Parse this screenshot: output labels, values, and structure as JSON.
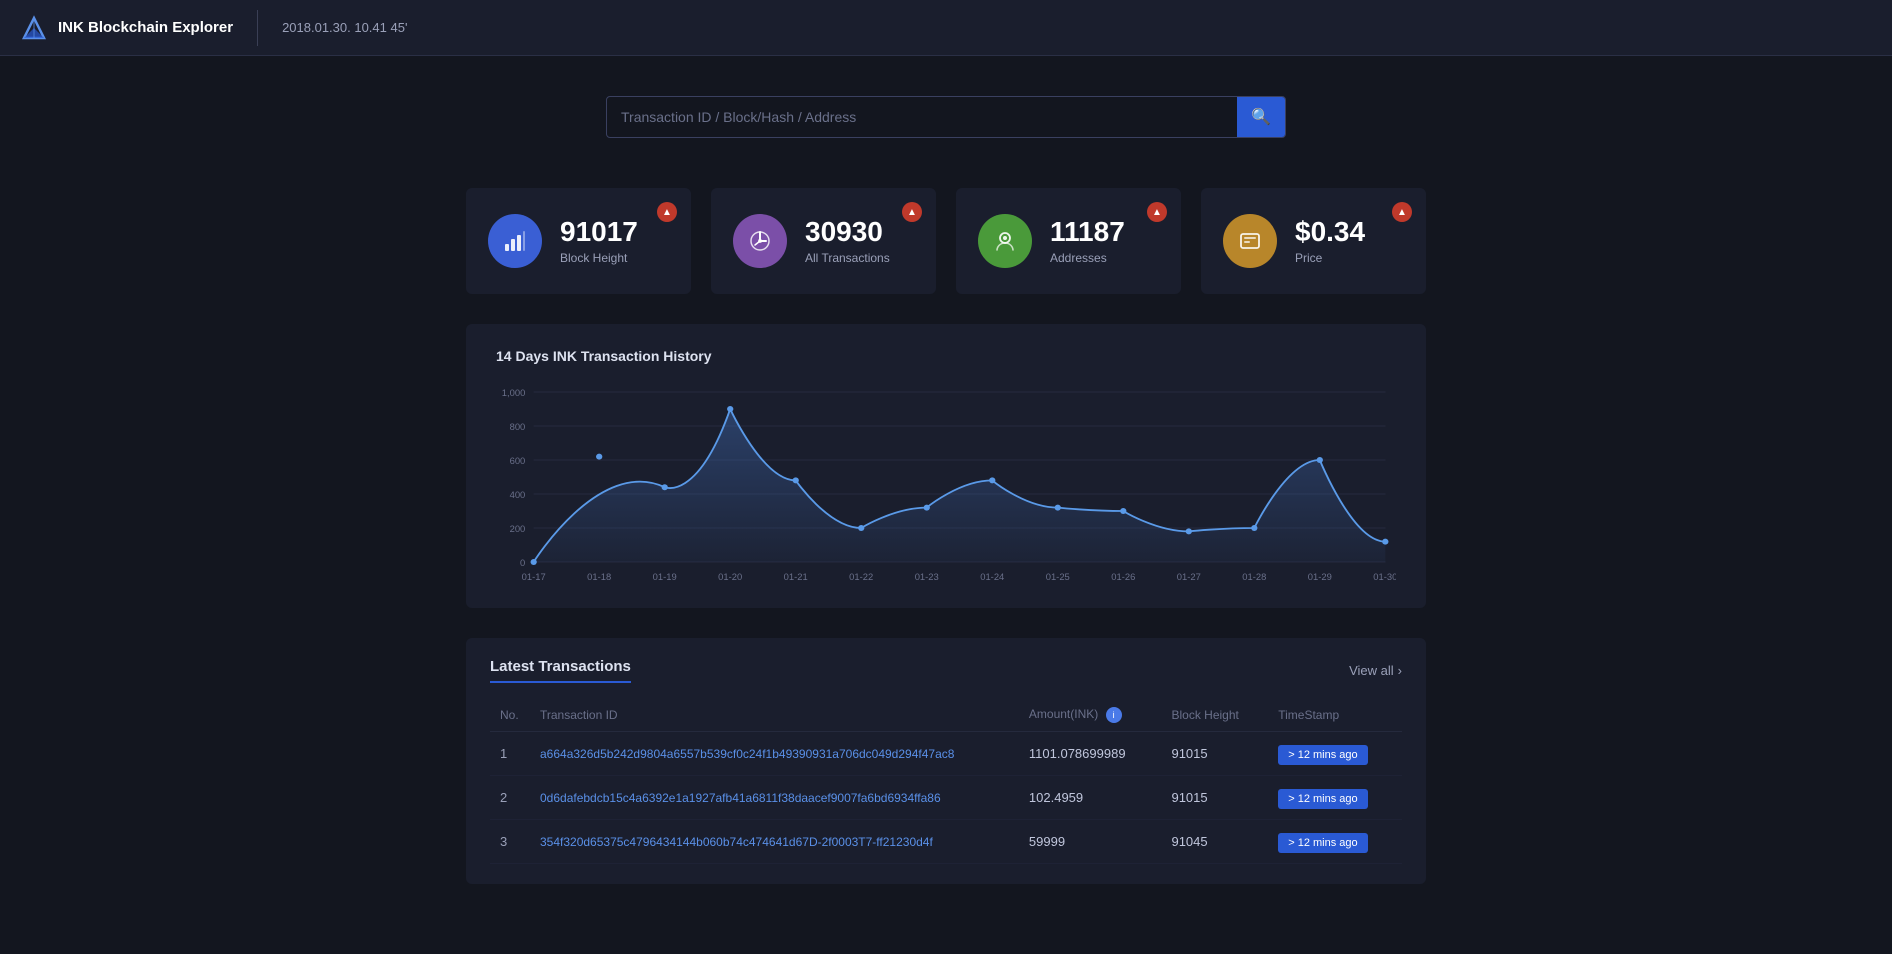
{
  "app": {
    "name": "INK Blockchain Explorer",
    "logo_text": "INK Blockchain Explorer"
  },
  "header": {
    "time": "2018.01.30.  10.41 45'"
  },
  "search": {
    "placeholder": "Transaction ID / Block/Hash / Address"
  },
  "stats": [
    {
      "value": "91017",
      "label": "Block Height",
      "icon_type": "blue",
      "icon_symbol": "📊",
      "trend": "up"
    },
    {
      "value": "30930",
      "label": "All Transactions",
      "icon_type": "purple",
      "icon_symbol": "🕐",
      "trend": "up"
    },
    {
      "value": "11187",
      "label": "Addresses",
      "icon_type": "green",
      "icon_symbol": "📍",
      "trend": "up"
    },
    {
      "value": "$0.34",
      "label": "Price",
      "icon_type": "gold",
      "icon_symbol": "🖼",
      "trend": "up"
    }
  ],
  "chart": {
    "title": "14 Days INK Transaction History",
    "x_labels": [
      "01-17",
      "01-18",
      "01-19",
      "01-20",
      "01-21",
      "01-22",
      "01-23",
      "01-24",
      "01-25",
      "01-26",
      "01-27",
      "01-28",
      "01-29",
      "01-30"
    ],
    "y_labels": [
      "0",
      "200",
      "400",
      "600",
      "800",
      "1,000"
    ],
    "data_points": [
      0,
      620,
      440,
      900,
      480,
      200,
      320,
      480,
      320,
      300,
      180,
      200,
      600,
      120
    ]
  },
  "transactions": {
    "title": "Latest Transactions",
    "view_all": "View all",
    "columns": [
      "No.",
      "Transaction ID",
      "Amount(INK)",
      "Block Height",
      "TimeStamp"
    ],
    "rows": [
      {
        "no": "1",
        "tx_id": "a664a326d5b242d9804a6557b539cf0c24f1b49390931a706dc049d294f47ac8",
        "amount": "1101.078699989",
        "block_height": "91015",
        "timestamp": "> 12 mins ago"
      },
      {
        "no": "2",
        "tx_id": "0d6dafebdcb15c4a6392e1a1927afb41a6811f38daacef9007fa6bd6934ffa86",
        "amount": "102.4959",
        "block_height": "91015",
        "timestamp": "> 12 mins ago"
      },
      {
        "no": "3",
        "tx_id": "354f320d65375c4796434144b060b74c474641d67D-2f0003T7-ff21230d4f",
        "amount": "59999",
        "block_height": "91045",
        "timestamp": "> 12 mins ago"
      }
    ]
  },
  "icons": {
    "search": "🔍",
    "trend_up": "▲",
    "chevron_right": "›"
  }
}
